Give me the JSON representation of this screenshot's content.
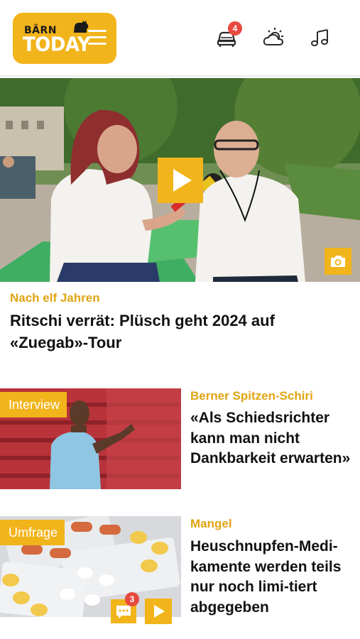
{
  "header": {
    "logo_top": "BÄRN",
    "logo_bottom": "TODAY",
    "traffic_badge": "4",
    "icons": [
      "car-icon",
      "weather-icon",
      "music-note-icon",
      "menu-icon"
    ]
  },
  "hero": {
    "kicker": "Nach elf Jahren",
    "title": "Ritschi verrät: Plüsch geht 2024 auf «Zuegab»-Tour"
  },
  "articles": [
    {
      "tag": "Interview",
      "kicker": "Berner Spitzen-Schiri",
      "title": "«Als Schiedsrichter kann man nicht Dankbarkeit erwarten»"
    },
    {
      "tag": "Umfrage",
      "kicker": "Mangel",
      "title": "Heuschnupfen-Medi-kamente werden teils nur noch limi-tiert abgegeben",
      "comment_count": "3"
    }
  ],
  "colors": {
    "brand_yellow": "#F2B41B",
    "kicker_yellow": "#E0A412",
    "badge_red": "#E8493F"
  }
}
